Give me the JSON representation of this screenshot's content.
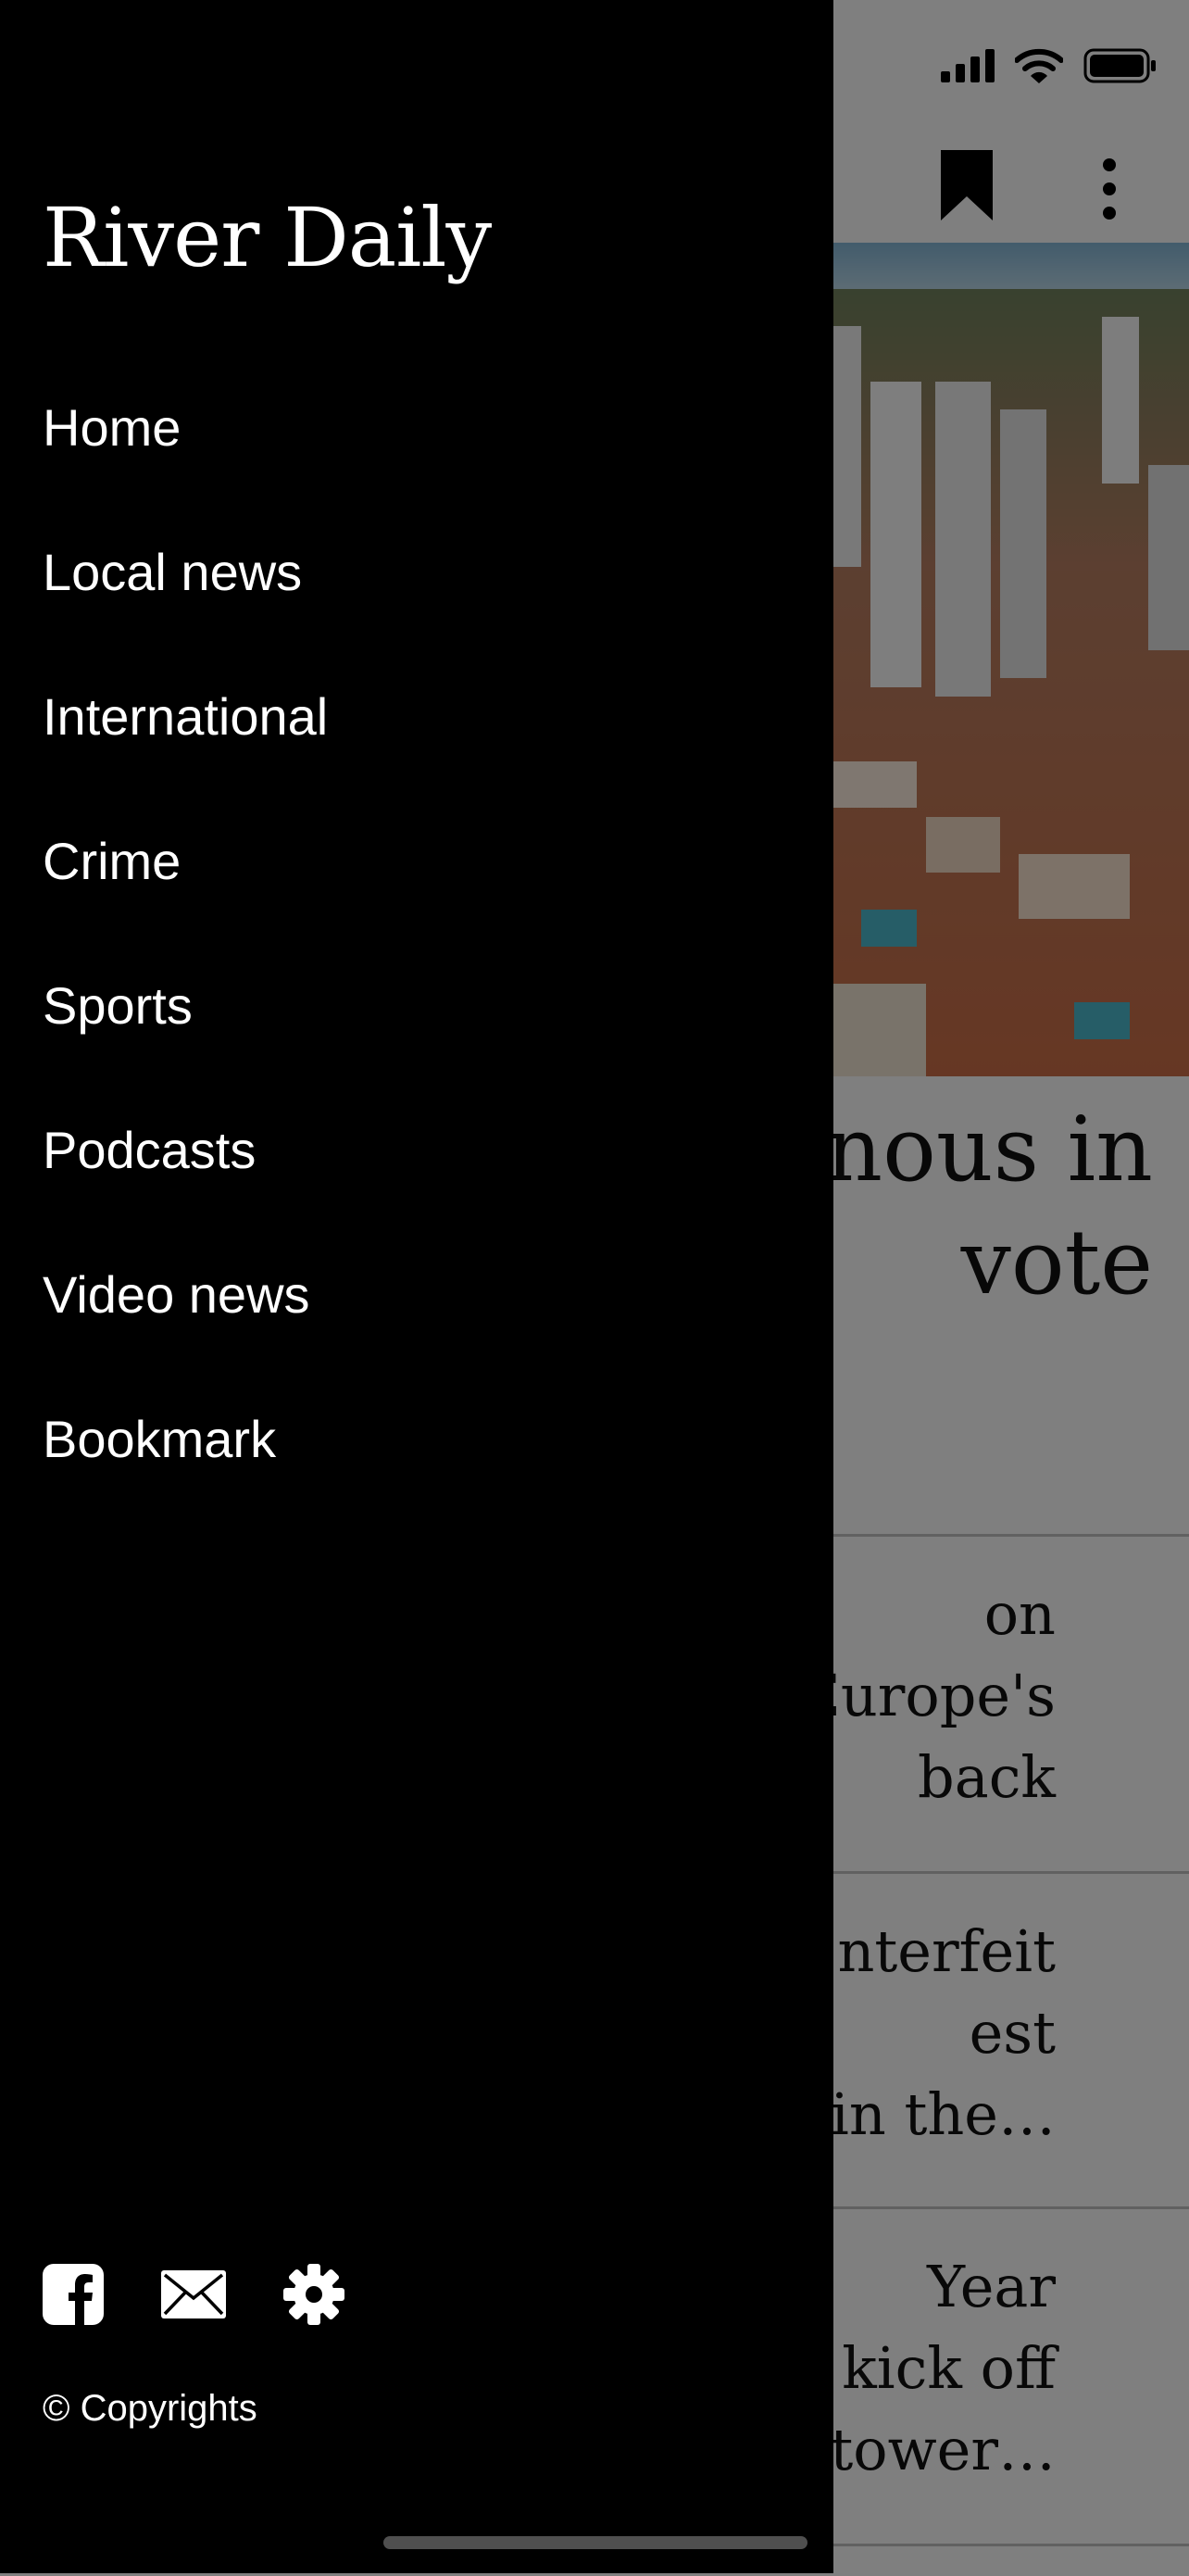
{
  "drawer": {
    "title": "River Daily",
    "nav": [
      {
        "label": "Home"
      },
      {
        "label": "Local news"
      },
      {
        "label": "International"
      },
      {
        "label": "Crime"
      },
      {
        "label": "Sports"
      },
      {
        "label": "Podcasts"
      },
      {
        "label": "Video news"
      },
      {
        "label": "Bookmark"
      }
    ],
    "footer_icons": [
      "facebook-icon",
      "mail-icon",
      "gear-icon"
    ],
    "copyright": "© Copyrights"
  },
  "background": {
    "headline": [
      "onous in",
      "vote"
    ],
    "stories": [
      {
        "lines": [
          "on",
          "Europe's",
          "back"
        ]
      },
      {
        "lines": [
          "nterfeit",
          "est",
          "in the…"
        ]
      },
      {
        "lines": [
          "Year",
          "kick off",
          "by tower…"
        ]
      }
    ],
    "app_bar_icons": [
      "bookmark-icon",
      "more-vertical-icon"
    ],
    "status_icons": [
      "signal-icon",
      "wifi-icon",
      "battery-icon"
    ]
  },
  "colors": {
    "drawer_bg": "#000000",
    "drawer_text": "#ffffff",
    "scrim": "rgba(0,0,0,0.48)"
  }
}
